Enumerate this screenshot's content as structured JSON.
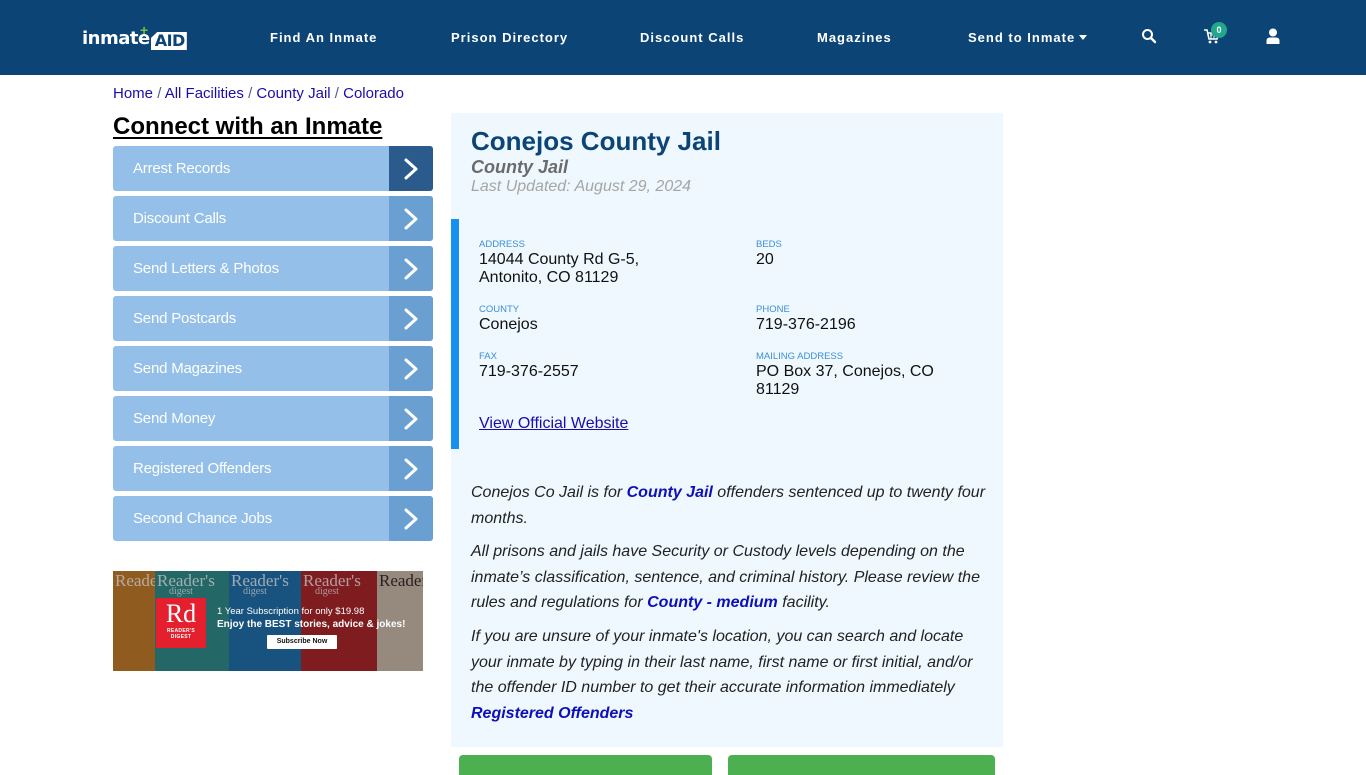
{
  "header": {
    "logo": {
      "text": "inmate",
      "accent": "AID"
    },
    "nav": [
      {
        "label": "Find An Inmate"
      },
      {
        "label": "Prison Directory"
      },
      {
        "label": "Discount Calls"
      },
      {
        "label": "Magazines"
      },
      {
        "label": "Send to Inmate",
        "has_dropdown": true
      }
    ],
    "icons": {
      "search": "search-icon",
      "cart": "cart-icon",
      "user": "user-icon"
    },
    "cart_count": "0"
  },
  "breadcrumb": [
    {
      "label": "Home"
    },
    {
      "label": "All Facilities"
    },
    {
      "label": "County Jail"
    },
    {
      "label": "Colorado"
    }
  ],
  "breadcrumb_separator": "/",
  "sidebar": {
    "title": "Connect with an Inmate",
    "items": [
      {
        "label": "Arrest Records",
        "active": true
      },
      {
        "label": "Discount Calls"
      },
      {
        "label": "Send Letters & Photos"
      },
      {
        "label": "Send Postcards"
      },
      {
        "label": "Send Magazines"
      },
      {
        "label": "Send Money"
      },
      {
        "label": "Registered Offenders"
      },
      {
        "label": "Second Chance Jobs"
      }
    ]
  },
  "ad": {
    "brand_logo": "Rd",
    "brand_name_line1": "READER'S",
    "brand_name_line2": "DIGEST",
    "cover_masthead": "Reader's",
    "cover_sub": "digest",
    "line1": "1 Year Subscription for only $19.98",
    "line2": "Enjoy the BEST stories, advice & jokes!",
    "cta": "Subscribe Now"
  },
  "facility": {
    "name": "Conejos County Jail",
    "type": "County Jail",
    "last_updated": "Last Updated: August 29, 2024",
    "fields": {
      "address": {
        "label": "Address",
        "value_line1": "14044 County Rd G-5,",
        "value_line2": "Antonito, CO 81129"
      },
      "beds": {
        "label": "Beds",
        "value": "20"
      },
      "county": {
        "label": "County",
        "value": "Conejos"
      },
      "phone": {
        "label": "Phone",
        "value": "719-376-2196"
      },
      "fax": {
        "label": "Fax",
        "value": "719-376-2557"
      },
      "mailing_address": {
        "label": "Mailing Address",
        "value_line1": "PO Box 37, Conejos, CO",
        "value_line2": "81129"
      }
    },
    "website_link": "View Official Website"
  },
  "description": {
    "p1_before": "Conejos Co Jail is for ",
    "p1_link": "County Jail",
    "p1_after": " offenders sentenced up to twenty four months.",
    "p2_before": "All prisons and jails have Security or Custody levels depending on the inmate’s classification, sentence, and criminal history. Please review the rules and regulations for ",
    "p2_link": "County - medium",
    "p2_after": " facility.",
    "p3_text": "If you are unsure of your inmate's location, you can search and locate your inmate by typing in their last name, first name or first initial, and/or the offender ID number to get their accurate information immediately",
    "p3_link": "Registered Offenders"
  },
  "colors": {
    "header_bg": "#0c4476",
    "sidebar_item_bg": "#94bfe8",
    "sidebar_arrow_bg": "#6a9fd2",
    "sidebar_arrow_active_bg": "#2b5b8c",
    "panel_bg": "#eef8fe",
    "info_accent": "#1890f0",
    "cart_badge": "#21a88a",
    "cta_green": "#4caf50",
    "link": "#1a0dab"
  }
}
